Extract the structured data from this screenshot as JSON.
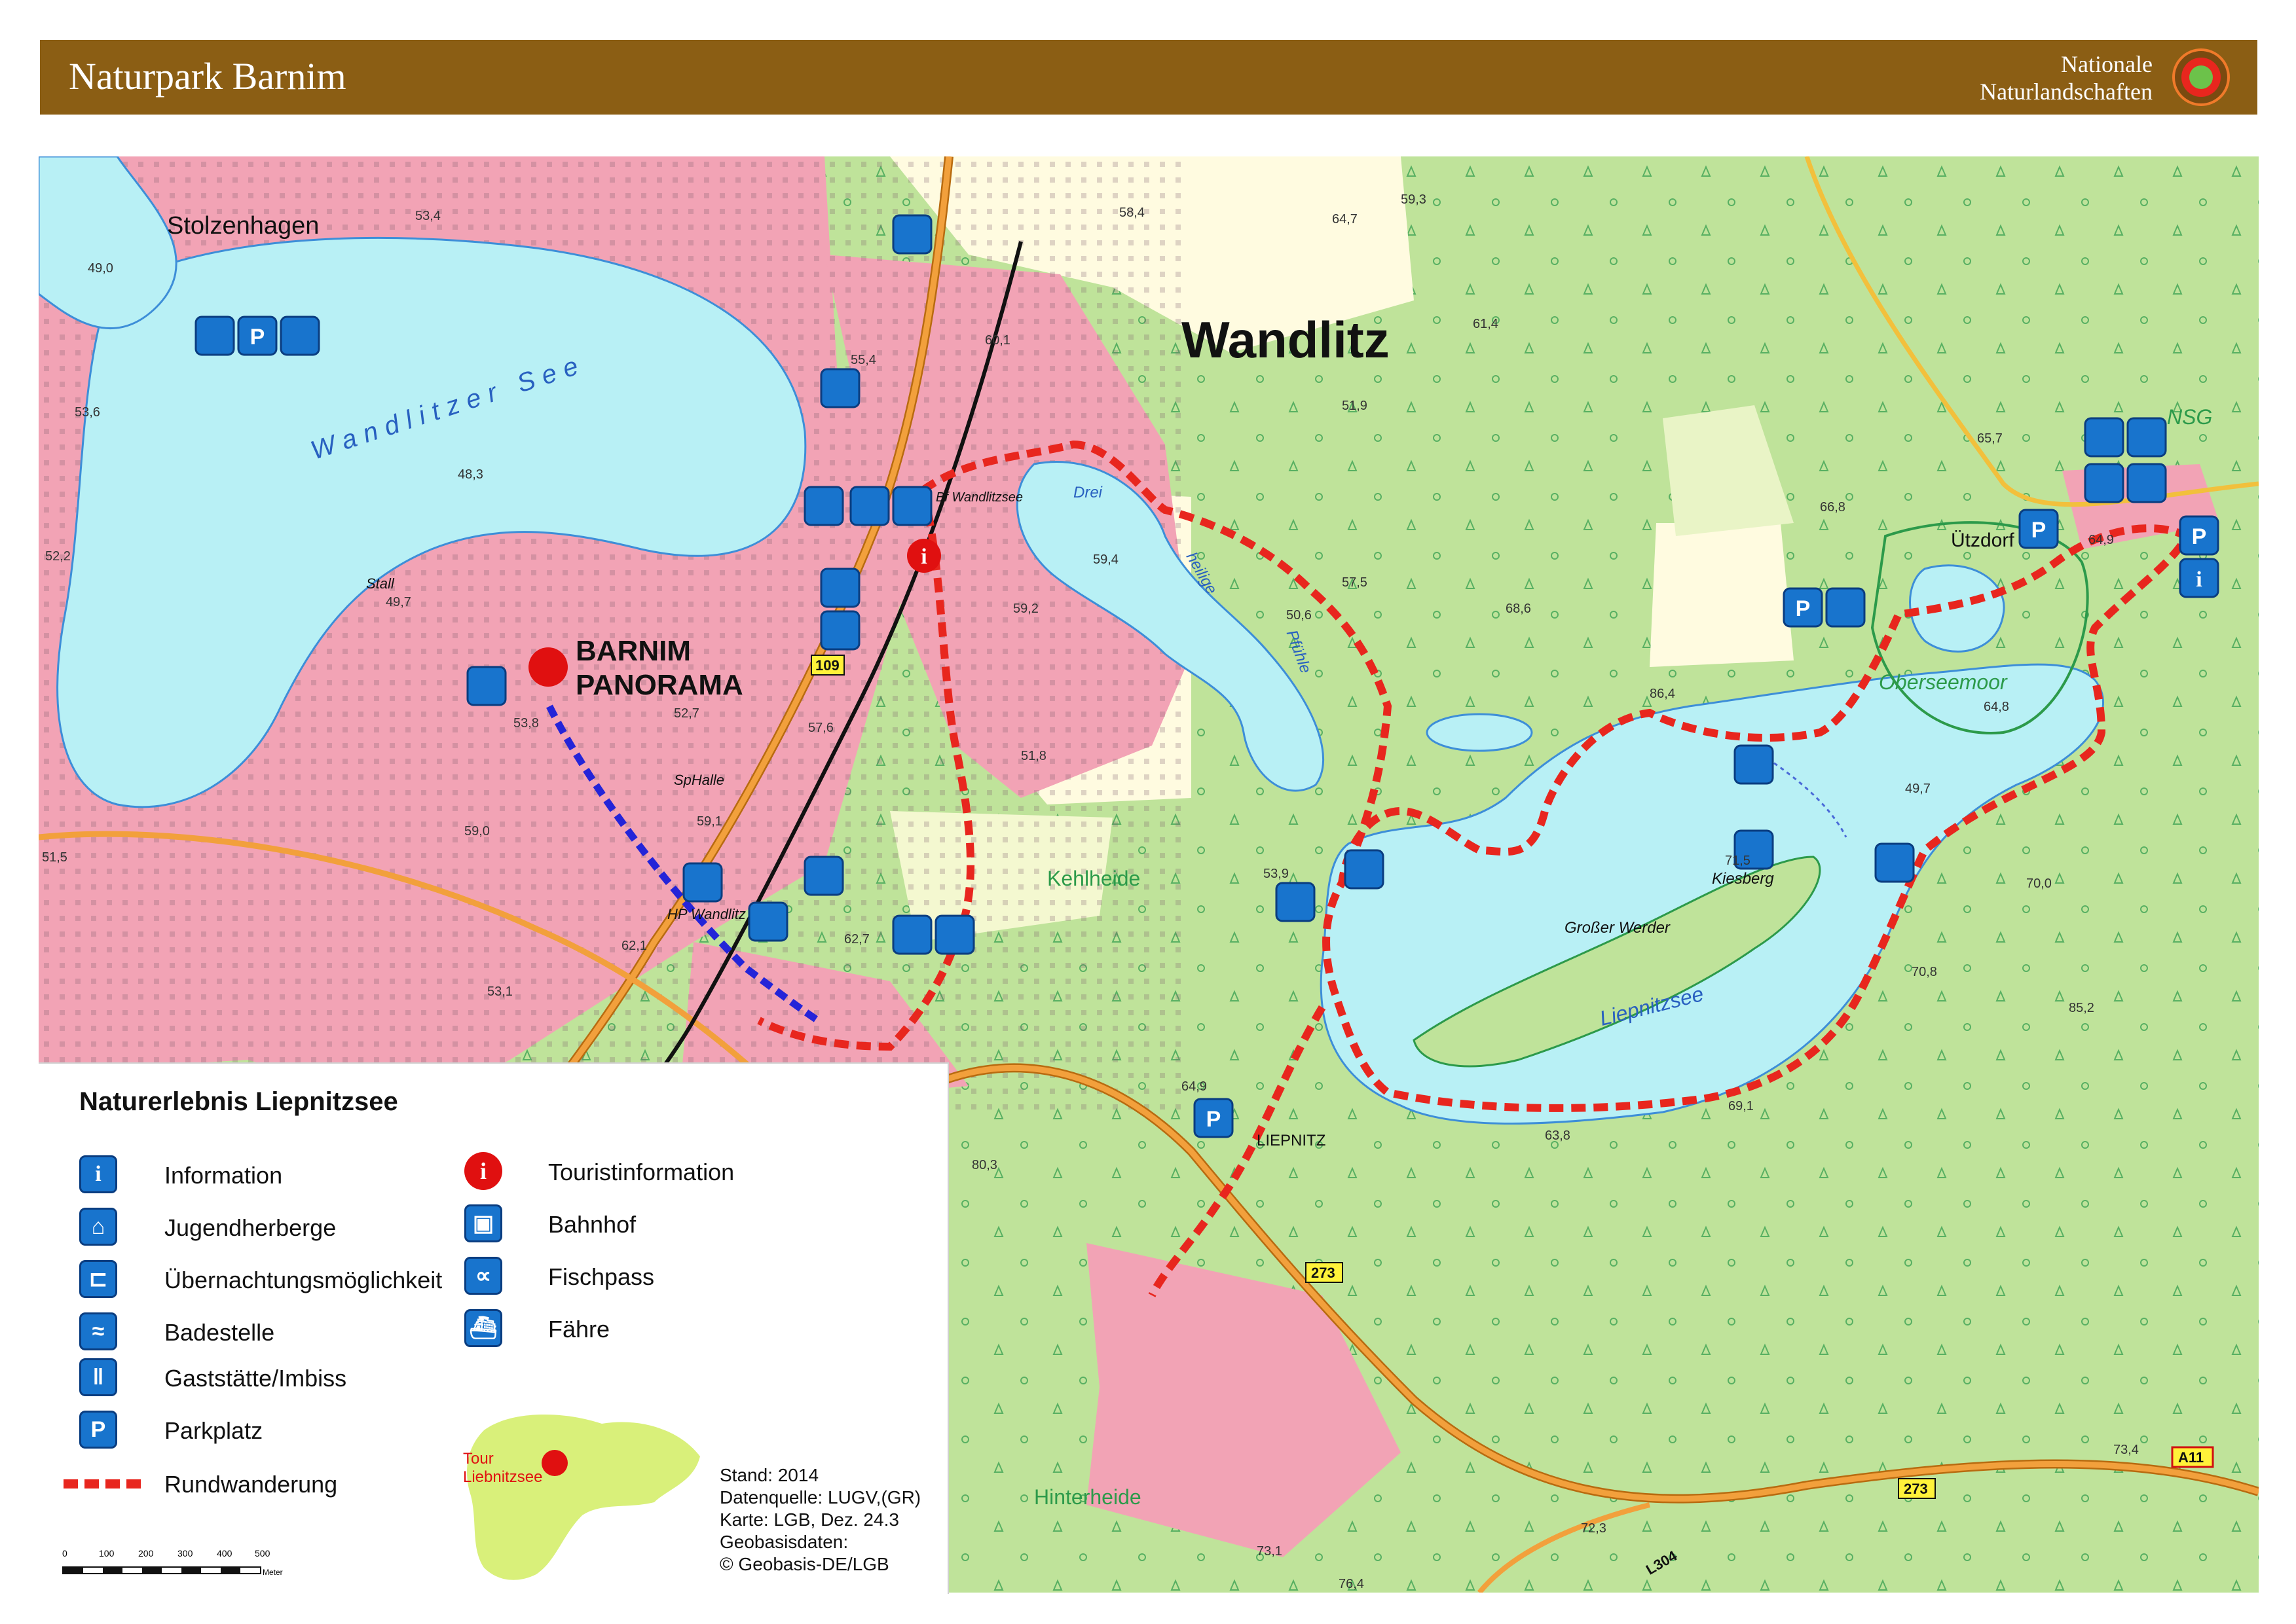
{
  "header": {
    "title": "Naturpark Barnim",
    "brand_line1": "Nationale",
    "brand_line2": "Naturlandschaften",
    "bar_color": "#8b5e14",
    "logo_icon": "nationale-naturlandschaften-logo"
  },
  "map": {
    "colors": {
      "forest": "#bfe39a",
      "lake": "#b8f0f5",
      "settlement": "#f2a3b5",
      "road": "#f2a03c",
      "route": "#e8261e",
      "blue_route": "#2424d8",
      "meadow": "#fffbe0"
    },
    "places": {
      "wandlitz": "Wandlitz",
      "stolzenhagen": "Stolzenhagen",
      "utzdorf": "Ützdorf",
      "liepnitz": "LIEPNITZ",
      "kehlheide": "Kehlheide",
      "hinterheide": "Hinterheide",
      "oberseemoor": "Oberseemoor",
      "nsg": "NSG"
    },
    "waters": {
      "wandlitzer_see": "Wandlitzer See",
      "liepnitzsee": "Liepnitzsee",
      "drei": "Drei",
      "heilige": "heilige",
      "pfuhle": "Pfühle"
    },
    "other": {
      "barnim_panorama_1": "BARNIM",
      "barnim_panorama_2": "PANORAMA",
      "kiesberg": "Kiesberg",
      "grosser_werder": "Großer Werder",
      "hp_wandlitz": "HP Wandlitz",
      "b_wandlitzsee": "Bf Wandlitzsee",
      "sphalle": "SpHalle",
      "stall": "Stall",
      "road_109": "109",
      "road_273a": "273",
      "road_273b": "273",
      "road_a11": "A11",
      "road_l304": "L304"
    },
    "spot_heights": [
      "53,4",
      "58,4",
      "64,7",
      "59,3",
      "60,1",
      "55,4",
      "49,0",
      "53,6",
      "48,3",
      "52,2",
      "49,7",
      "53,8",
      "52,7",
      "57,6",
      "59,4",
      "59,2",
      "61,4",
      "51,9",
      "57,5",
      "51,8",
      "53,9",
      "59,1",
      "62,1",
      "62,7",
      "59,0",
      "51,5",
      "53,1",
      "66,8",
      "65,7",
      "64,9",
      "68,6",
      "86,4",
      "64,8",
      "49,7",
      "71,5",
      "70,0",
      "70,8",
      "85,2",
      "63,8",
      "69,1",
      "64,9",
      "80,3",
      "73,4",
      "72,3",
      "73,1",
      "76,4",
      "50,6"
    ]
  },
  "legend": {
    "title": "Naturerlebnis Liepnitzsee",
    "items_left": [
      {
        "icon": "information-icon",
        "glyph": "i",
        "label": "Information"
      },
      {
        "icon": "youth-hostel-icon",
        "glyph": "⌂",
        "label": "Jugendherberge"
      },
      {
        "icon": "accommodation-icon",
        "glyph": "⊏",
        "label": "Übernachtungsmöglichkeit"
      },
      {
        "icon": "swimming-icon",
        "glyph": "≈",
        "label": "Badestelle"
      },
      {
        "icon": "restaurant-icon",
        "glyph": "ǁ",
        "label": "Gaststätte/Imbiss"
      },
      {
        "icon": "parking-icon",
        "glyph": "P",
        "label": "Parkplatz"
      }
    ],
    "items_right": [
      {
        "icon": "tourist-info-icon",
        "glyph": "i",
        "label": "Touristinformation"
      },
      {
        "icon": "train-station-icon",
        "glyph": "▣",
        "label": "Bahnhof"
      },
      {
        "icon": "fish-pass-icon",
        "glyph": "∝",
        "label": "Fischpass"
      },
      {
        "icon": "ferry-icon",
        "glyph": "⛴",
        "label": "Fähre"
      }
    ],
    "route_label": "Rundwanderung",
    "minimap_label_1": "Tour",
    "minimap_label_2": "Liebnitzsee",
    "stand": "Stand: 2014",
    "datenquelle": "Datenquelle: LUGV,(GR)",
    "karte": "Karte: LGB, Dez. 24.3",
    "geobasis": "Geobasisdaten:",
    "copyright": "© Geobasis-DE/LGB",
    "scale_ticks": [
      "0",
      "100",
      "200",
      "300",
      "400",
      "500"
    ],
    "scale_unit": "Meter"
  }
}
